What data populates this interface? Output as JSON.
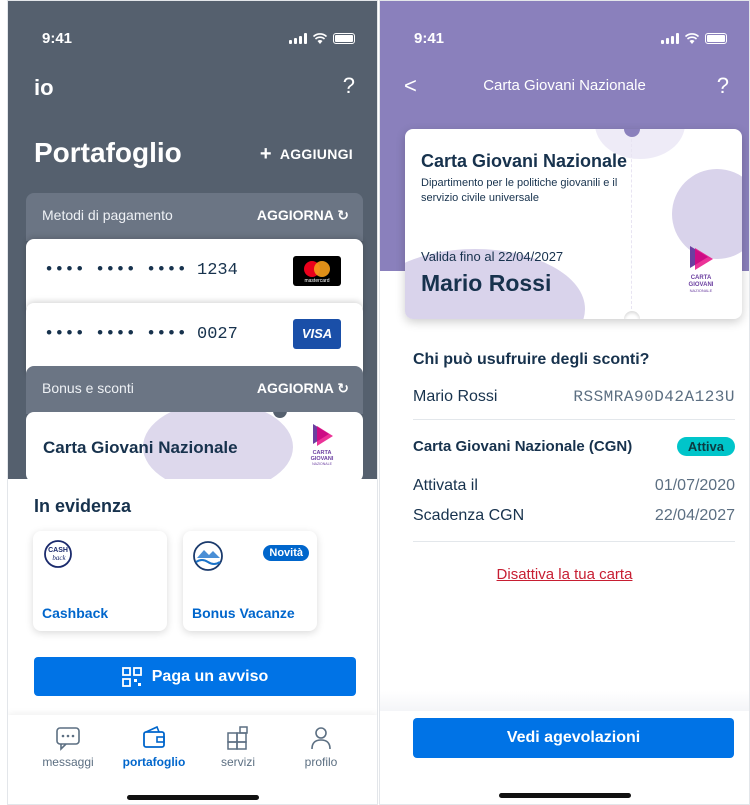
{
  "status_bar": {
    "time_left": "9:41",
    "time_right": "9:41"
  },
  "wallet": {
    "app_logo": "io",
    "help": "?",
    "title": "Portafoglio",
    "add_label": "AGGIUNGI",
    "payment_methods": {
      "title": "Metodi di pagamento",
      "refresh_label": "AGGIORNA",
      "cards": [
        {
          "number": "•••• •••• •••• 1234",
          "brand": "mastercard"
        },
        {
          "number": "•••• •••• •••• 0027",
          "brand": "VISA"
        }
      ]
    },
    "bonus": {
      "title": "Bonus e sconti",
      "refresh_label": "AGGIORNA",
      "card_title": "Carta Giovani Nazionale",
      "logo_text": [
        "CARTA",
        "GIOVANI",
        "NAZIONALE"
      ]
    },
    "featured": {
      "title": "In evidenza",
      "items": [
        {
          "label": "Cashback",
          "icon": "cashback-icon",
          "icon_text": [
            "CASH",
            "back"
          ]
        },
        {
          "label": "Bonus Vacanze",
          "icon": "bonus-vacanze-icon",
          "badge": "Novità"
        }
      ]
    },
    "pay_notice_label": "Paga un avviso",
    "tabs": [
      {
        "label": "messaggi",
        "icon": "messages-icon"
      },
      {
        "label": "portafoglio",
        "icon": "wallet-icon",
        "active": true
      },
      {
        "label": "servizi",
        "icon": "services-icon"
      },
      {
        "label": "profilo",
        "icon": "profile-icon"
      }
    ]
  },
  "cgn_detail": {
    "nav_title": "Carta Giovani Nazionale",
    "back": "<",
    "help": "?",
    "card": {
      "title": "Carta Giovani Nazionale",
      "department": "Dipartimento per le politiche giovanili e il servizio civile universale",
      "valid_until": "Valida fino al 22/04/2027",
      "owner": "Mario Rossi",
      "logo_text": [
        "CARTA",
        "GIOVANI",
        "NAZIONALE"
      ]
    },
    "who_title": "Chi può usufruire degli sconti?",
    "holder_name": "Mario Rossi",
    "fiscal_code": "RSSMRA90D42A123U",
    "status_label": "Carta Giovani Nazionale (CGN)",
    "status_value": "Attiva",
    "activated_label": "Attivata il",
    "activated_value": "01/07/2020",
    "expiry_label": "Scadenza CGN",
    "expiry_value": "22/04/2027",
    "deactivate_label": "Disattiva la tua carta",
    "cta_label": "Vedi agevolazioni"
  },
  "colors": {
    "wallet_header": "#55606e",
    "cgn_header": "#8a80bc",
    "primary": "#0073e6",
    "active_badge": "#00c5ca",
    "danger": "#c71e32"
  }
}
